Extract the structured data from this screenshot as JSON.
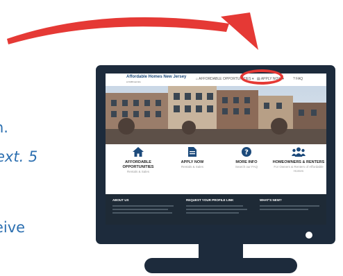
{
  "side_text": {
    "line1": "n.",
    "line2": "ext. 5",
    "line3": "eive"
  },
  "site": {
    "brand": "Affordable Homes New Jersey",
    "brand_sub": "a CHFA service",
    "nav": [
      {
        "icon": "home-icon",
        "label": "AFFORDABLE OPPORTUNITIES ▾"
      },
      {
        "icon": "document-icon",
        "label": "APPLY NOW ▾"
      },
      {
        "icon": "help-icon",
        "label": "FAQ"
      }
    ],
    "features": [
      {
        "icon": "home-icon",
        "title": "AFFORDABLE OPPORTUNITIES",
        "subtitle": "Rentals & Sales"
      },
      {
        "icon": "document-icon",
        "title": "APPLY NOW",
        "subtitle": "Rentals & Sales"
      },
      {
        "icon": "help-icon",
        "title": "MORE INFO",
        "subtitle": "Search our FAQ"
      },
      {
        "icon": "users-icon",
        "title": "HOMEOWNERS & RENTERS",
        "subtitle": "For Owners & Renters of Affordable Homes"
      }
    ],
    "footer": [
      {
        "heading": "ABOUT US"
      },
      {
        "heading": "REQUEST YOUR PROFILE LINK"
      },
      {
        "heading": "WHAT'S NEW?"
      }
    ]
  },
  "colors": {
    "accent_blue": "#1c4a7b",
    "monitor": "#1d2b3c",
    "highlight_red": "#e53935",
    "side_text": "#2c6fb0"
  }
}
